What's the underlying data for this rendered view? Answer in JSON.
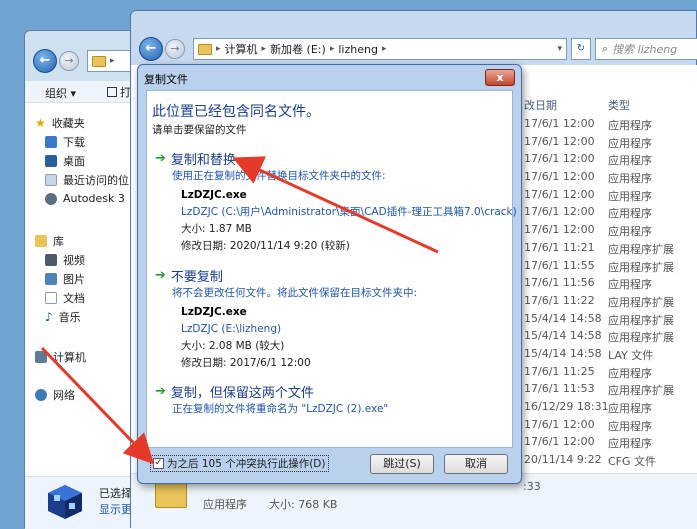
{
  "back_window": {
    "organize_label": "组织 ▾",
    "toolbar_partial": "打",
    "nav": {
      "favorites": "收藏夹",
      "favorites_items": [
        "下载",
        "桌面",
        "最近访问的位",
        "Autodesk 3"
      ],
      "libraries": "库",
      "libraries_items": [
        "视频",
        "图片",
        "文档",
        "音乐"
      ],
      "computer": "计算机",
      "network": "网络"
    },
    "status_line1": "已选择",
    "status_line2": "显示更"
  },
  "front_window": {
    "address": {
      "crumbs": [
        "计算机",
        "新加卷 (E:)",
        "lizheng"
      ]
    },
    "search_placeholder": "搜索 lizheng",
    "columns": {
      "date": "改日期",
      "type": "类型"
    },
    "rows": [
      {
        "date": "17/6/1 12:00",
        "type": "应用程序"
      },
      {
        "date": "17/6/1 12:00",
        "type": "应用程序"
      },
      {
        "date": "17/6/1 12:00",
        "type": "应用程序"
      },
      {
        "date": "17/6/1 12:00",
        "type": "应用程序"
      },
      {
        "date": "17/6/1 12:00",
        "type": "应用程序"
      },
      {
        "date": "17/6/1 12:00",
        "type": "应用程序"
      },
      {
        "date": "17/6/1 12:00",
        "type": "应用程序"
      },
      {
        "date": "17/6/1 11:21",
        "type": "应用程序扩展"
      },
      {
        "date": "17/6/1 11:55",
        "type": "应用程序扩展"
      },
      {
        "date": "17/6/1 11:56",
        "type": "应用程序"
      },
      {
        "date": "17/6/1 11:22",
        "type": "应用程序扩展"
      },
      {
        "date": "15/4/14 14:58",
        "type": "应用程序扩展"
      },
      {
        "date": "15/4/14 14:58",
        "type": "应用程序扩展"
      },
      {
        "date": "15/4/14 14:58",
        "type": "LAY 文件"
      },
      {
        "date": "17/6/1 11:25",
        "type": "应用程序"
      },
      {
        "date": "17/6/1 11:53",
        "type": "应用程序扩展"
      },
      {
        "date": "16/12/29 18:31",
        "type": "应用程序"
      },
      {
        "date": "17/6/1 12:00",
        "type": "应用程序"
      },
      {
        "date": "17/6/1 12:00",
        "type": "应用程序"
      },
      {
        "date": "20/11/14 9:22",
        "type": "CFG 文件"
      }
    ],
    "status": {
      "time_partial": ":33",
      "file_type": "应用程序",
      "size": "大小: 768 KB"
    }
  },
  "dialog": {
    "title": "复制文件",
    "close_label": "x",
    "heading": "此位置已经包含同名文件。",
    "subheading": "请单击要保留的文件",
    "replace": {
      "title": "复制和替换",
      "desc": "使用正在复制的文件替换目标文件夹中的文件:",
      "filename": "LzDZJC.exe",
      "path": "LzDZJC (C:\\用户\\Administrator\\桌面\\CAD插件-理正工具箱7.0\\crack)",
      "size": "大小: 1.87 MB",
      "modified": "修改日期: 2020/11/14 9:20 (较新)"
    },
    "skip": {
      "title": "不要复制",
      "desc": "将不会更改任何文件。将此文件保留在目标文件夹中:",
      "filename": "LzDZJC.exe",
      "path": "LzDZJC (E:\\lizheng)",
      "size": "大小: 2.08 MB (较大)",
      "modified": "修改日期: 2017/6/1 12:00"
    },
    "keep_both": {
      "title": "复制，但保留这两个文件",
      "desc": "正在复制的文件将重命名为 \"LzDZJC (2).exe\""
    },
    "apply_all_checked": true,
    "apply_all_label": "为之后 105 个冲突执行此操作(D)",
    "skip_button": "跳过(S)",
    "cancel_button": "取消"
  },
  "colors": {
    "annotation_arrow": "#e53a2a",
    "link_blue": "#1a3e8c",
    "green_arrow": "#2c9a2c"
  }
}
